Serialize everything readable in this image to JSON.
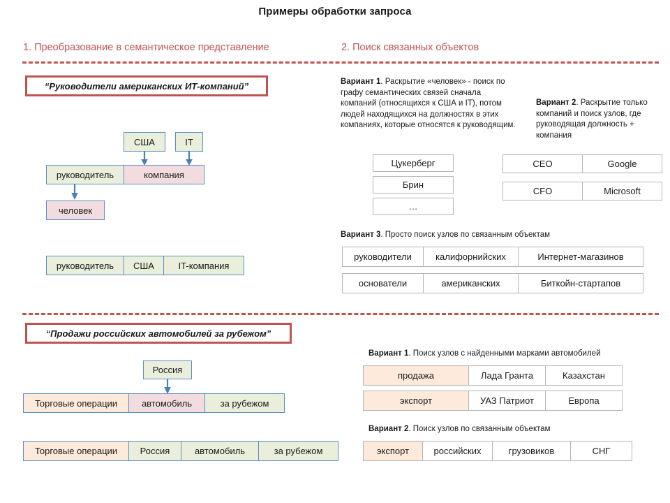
{
  "title": "Примеры обработки запроса",
  "sections": {
    "left_header": "1. Преобразование в семантическое представление",
    "right_header": "2. Поиск связанных объектов"
  },
  "colors": {
    "accent_red": "#bf5350",
    "node_border_blue": "#5a8ec4",
    "fill_green": "#eaefdc",
    "fill_pink": "#f2dcdf",
    "fill_peach": "#fdeadb",
    "cell_border_grey": "#b5b5b5"
  },
  "example1": {
    "query": "“Руководители американских ИТ-компаний”",
    "graph": {
      "node_usa": "США",
      "node_it": "IT",
      "node_manager": "руководитель",
      "node_company": "компания",
      "node_person": "человек"
    },
    "flat_row": [
      "руководитель",
      "США",
      "IT-компания"
    ],
    "variant1": {
      "label": "Вариант 1",
      "text": ". Раскрытие «человек» - поиск по графу семантических связей сначала компаний (относящихся к США и IT), потом людей находящихся на должностях  в этих компаниях, которые относятся  к руководящим.",
      "results": [
        "Цукерберг",
        "Брин",
        "…"
      ]
    },
    "variant2": {
      "label": "Вариант 2",
      "text": ". Раскрытие только компаний и поиск узлов, где руководящая должность + компания",
      "rows": [
        [
          "CEO",
          "Google"
        ],
        [
          "CFO",
          "Microsoft"
        ]
      ]
    },
    "variant3": {
      "label": "Вариант 3",
      "text": ". Просто поиск узлов по связанным объектам",
      "rows": [
        [
          "руководители",
          "калифорнийских",
          "Интернет-магазинов"
        ],
        [
          "основатели",
          "американских",
          "Биткойн-стартапов"
        ]
      ]
    }
  },
  "example2": {
    "query": "“Продажи российских автомобилей за рубежом”",
    "graph": {
      "node_russia": "Россия",
      "node_trade": "Торговые операции",
      "node_car": "автомобиль",
      "node_abroad": "за рубежом"
    },
    "flat_row": [
      "Торговые операции",
      "Россия",
      "автомобиль",
      "за рубежом"
    ],
    "variant1": {
      "label": "Вариант 1",
      "text": ". Поиск узлов с найденными марками автомобилей",
      "rows": [
        [
          "продажа",
          "Лада Гранта",
          "Казахстан"
        ],
        [
          "экспорт",
          "УАЗ Патриот",
          "Европа"
        ]
      ]
    },
    "variant2": {
      "label": "Вариант 2",
      "text": ". Поиск узлов по связанным объектам",
      "rows": [
        [
          "экспорт",
          "российских",
          "грузовиков",
          "СНГ"
        ]
      ]
    }
  }
}
